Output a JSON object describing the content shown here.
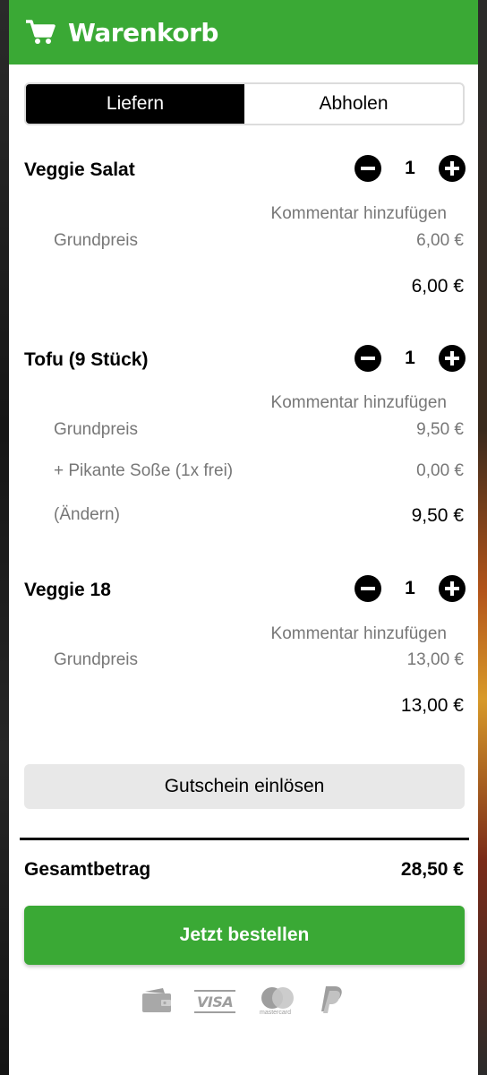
{
  "header": {
    "title": "Warenkorb",
    "icon": "shopping-cart-icon",
    "color": "#3aa935"
  },
  "mode_toggle": {
    "options": [
      "Liefern",
      "Abholen"
    ],
    "selected": "Liefern"
  },
  "items": [
    {
      "name": "Veggie Salat",
      "quantity": "1",
      "comment_label": "Kommentar hinzufügen",
      "lines": [
        {
          "label": "Grundpreis",
          "price": "6,00 €"
        }
      ],
      "total": "6,00 €"
    },
    {
      "name": "Tofu (9 Stück)",
      "quantity": "1",
      "comment_label": "Kommentar hinzufügen",
      "lines": [
        {
          "label": "Grundpreis",
          "price": "9,50 €"
        },
        {
          "label": "+ Pikante Soße (1x frei)",
          "price": "0,00 €"
        }
      ],
      "change_label": "(Ändern)",
      "total": "9,50 €"
    },
    {
      "name": "Veggie 18",
      "quantity": "1",
      "comment_label": "Kommentar hinzufügen",
      "lines": [
        {
          "label": "Grundpreis",
          "price": "13,00 €"
        }
      ],
      "total": "13,00 €"
    }
  ],
  "voucher_label": "Gutschein einlösen",
  "summary": {
    "total_label": "Gesamtbetrag",
    "total_value": "28,50 €"
  },
  "order_button_label": "Jetzt bestellen",
  "payment_methods": {
    "icons": [
      "wallet-icon",
      "visa-icon",
      "mastercard-icon",
      "paypal-icon"
    ],
    "visa_text": "VISA",
    "mastercard_text": "mastercard"
  }
}
